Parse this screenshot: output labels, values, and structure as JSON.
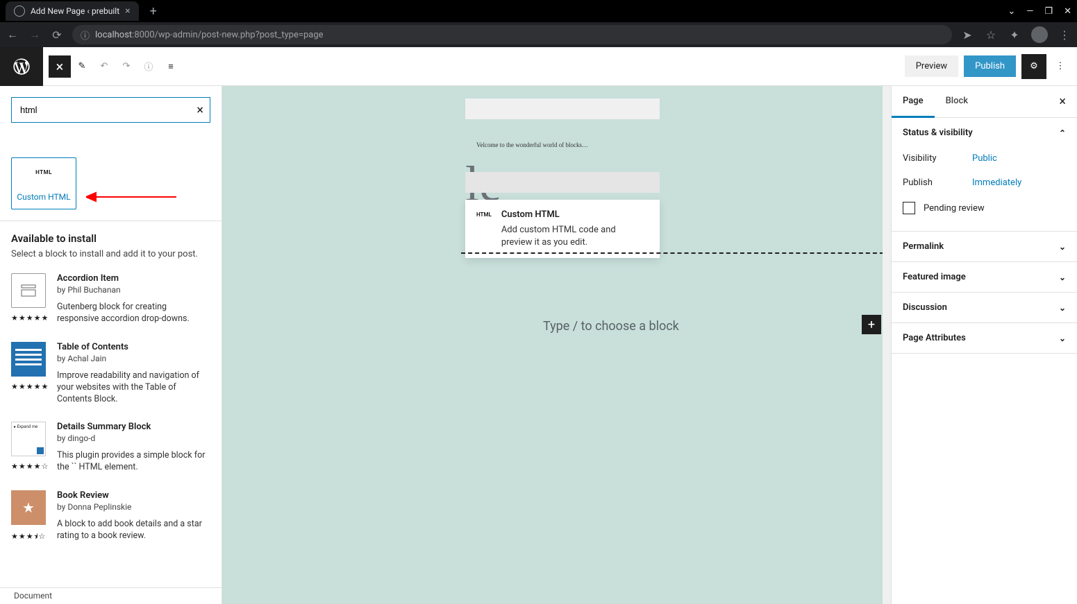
{
  "browser": {
    "tab_title": "Add New Page ‹ prebuilt",
    "url_host": "localhost",
    "url_port": ":8000",
    "url_path": "/wp-admin/post-new.php?post_type=page"
  },
  "toolbar": {
    "preview": "Preview",
    "publish": "Publish"
  },
  "inserter": {
    "search_value": "html",
    "block": {
      "icon_label": "HTML",
      "name": "Custom HTML"
    },
    "install_title": "Available to install",
    "install_sub": "Select a block to install and add it to your post.",
    "plugins": [
      {
        "name": "Accordion Item",
        "by": "by Phil Buchanan",
        "desc": "Gutenberg block for creating responsive accordion drop-downs.",
        "stars": "★★★★★"
      },
      {
        "name": "Table of Contents",
        "by": "by Achal Jain",
        "desc": "Improve readability and navigation of your websites with the Table of Contents Block.",
        "stars": "★★★★★"
      },
      {
        "name": "Details Summary Block",
        "by": "by dingo-d",
        "desc": "This plugin provides a simple block for the `` HTML element.",
        "stars": "★★★★☆"
      },
      {
        "name": "Book Review",
        "by": "by Donna Peplinskie",
        "desc": "A block to add book details and a star rating to a book review.",
        "stars": "★★★⯨☆"
      }
    ],
    "doc_status": "Document"
  },
  "canvas": {
    "title_placeholder": "le",
    "preview_welcome": "Velcome to the wonderful world of blocks…",
    "popover": {
      "icon": "HTML",
      "title": "Custom HTML",
      "desc": "Add custom HTML code and preview it as you edit."
    },
    "choose_block": "Type / to choose a block"
  },
  "sidebar": {
    "tabs": {
      "page": "Page",
      "block": "Block"
    },
    "panels": {
      "status": {
        "title": "Status & visibility",
        "visibility_label": "Visibility",
        "visibility_value": "Public",
        "publish_label": "Publish",
        "publish_value": "Immediately",
        "pending": "Pending review"
      },
      "permalink": "Permalink",
      "featured": "Featured image",
      "discussion": "Discussion",
      "attributes": "Page Attributes"
    }
  }
}
